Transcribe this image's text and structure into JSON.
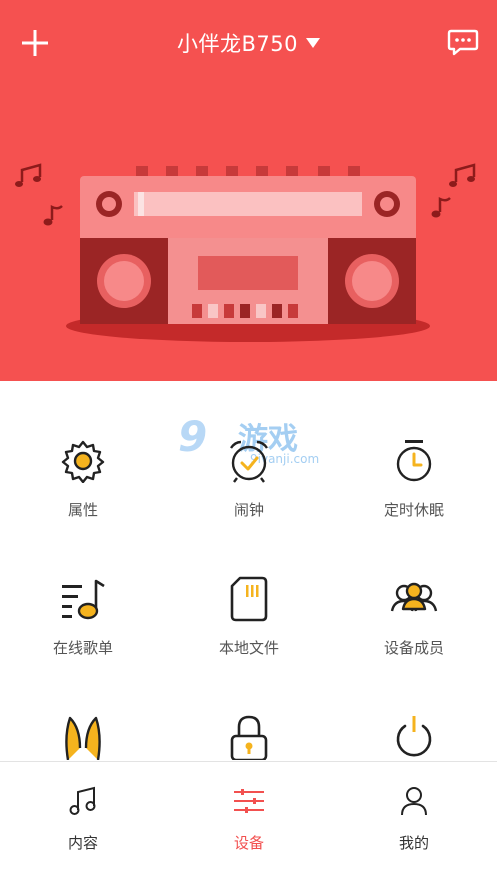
{
  "header": {
    "title": "小伴龙B750",
    "add_icon": "plus-icon",
    "dropdown_icon": "triangle-down-icon",
    "message_icon": "chat-bubble-icon"
  },
  "watermark": {
    "number": "9",
    "text": "游戏",
    "url": "9ivanji.com"
  },
  "features": [
    {
      "label": "属性",
      "icon": "gear-icon"
    },
    {
      "label": "闹钟",
      "icon": "alarm-clock-icon"
    },
    {
      "label": "定时休眠",
      "icon": "timer-icon"
    },
    {
      "label": "在线歌单",
      "icon": "playlist-icon"
    },
    {
      "label": "本地文件",
      "icon": "sd-card-icon"
    },
    {
      "label": "设备成员",
      "icon": "members-icon"
    },
    {
      "label": "",
      "icon": "bunny-ears-icon"
    },
    {
      "label": "",
      "icon": "lock-icon"
    },
    {
      "label": "",
      "icon": "power-icon"
    }
  ],
  "tabs": [
    {
      "label": "内容",
      "icon": "music-note-icon",
      "active": false
    },
    {
      "label": "设备",
      "icon": "sliders-icon",
      "active": true
    },
    {
      "label": "我的",
      "icon": "user-icon",
      "active": false
    }
  ],
  "colors": {
    "brand_red": "#f55150",
    "accent_yellow": "#f5b31e",
    "icon_dark": "#222222"
  }
}
